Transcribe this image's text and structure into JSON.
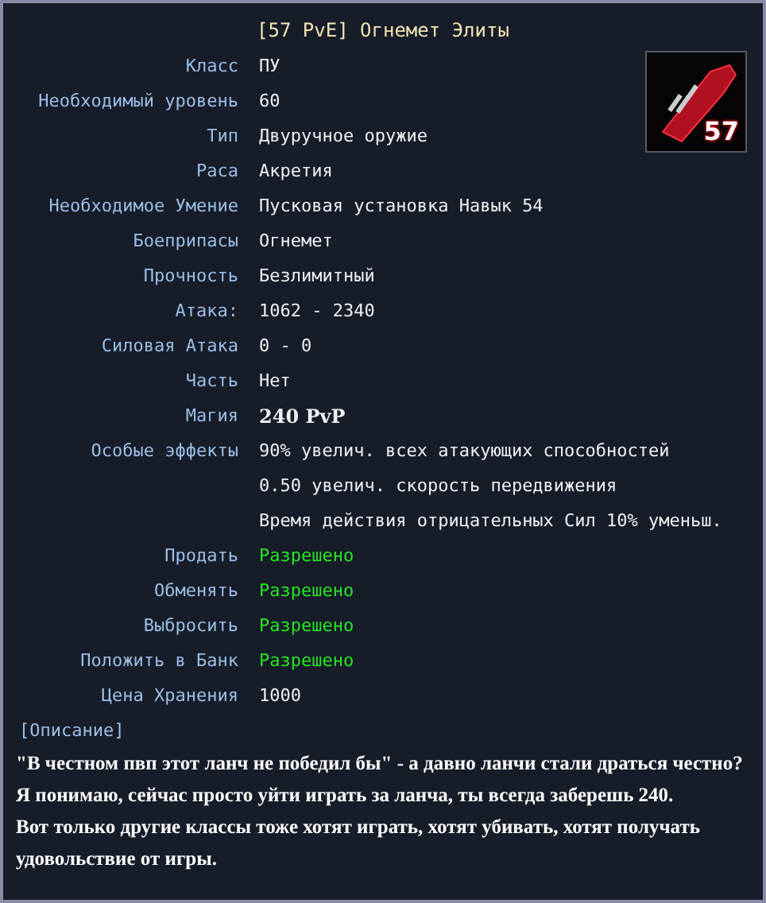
{
  "title": "[57 PvE] Огнемет Элиты",
  "icon_badge": "57",
  "rows": [
    {
      "label": "Класс",
      "value": "ПУ",
      "kind": "text"
    },
    {
      "label": "Необходимый уровень",
      "value": "60",
      "kind": "text"
    },
    {
      "label": "Тип",
      "value": "Двуручное оружие",
      "kind": "text"
    },
    {
      "label": "Раса",
      "value": "Акретия",
      "kind": "text"
    },
    {
      "label": "Необходимое Умение",
      "value": "Пусковая установка Навык 54",
      "kind": "text"
    },
    {
      "label": "Боеприпасы",
      "value": "Огнемет",
      "kind": "text"
    },
    {
      "label": "Прочность",
      "value": "Безлимитный",
      "kind": "text"
    },
    {
      "label": "Атака:",
      "value": "1062 - 2340",
      "kind": "text"
    },
    {
      "label": "Силовая Атака",
      "value": "0 - 0",
      "kind": "text"
    },
    {
      "label": "Часть",
      "value": "Нет",
      "kind": "text"
    },
    {
      "label": "Магия",
      "value": "240 PvP",
      "kind": "magic"
    },
    {
      "label": "Особые эффекты",
      "value": "90% увелич. всех атакующих способностей",
      "kind": "text"
    },
    {
      "value": "0.50 увелич. скорость передвижения",
      "kind": "text"
    },
    {
      "value": "Время действия отрицательных Сил 10% уменьш.",
      "kind": "text"
    },
    {
      "label": "Продать",
      "value": "Разрешено",
      "kind": "allowed"
    },
    {
      "label": "Обменять",
      "value": "Разрешено",
      "kind": "allowed"
    },
    {
      "label": "Выбросить",
      "value": "Разрешено",
      "kind": "allowed"
    },
    {
      "label": "Положить в Банк",
      "value": "Разрешено",
      "kind": "allowed"
    },
    {
      "label": "Цена Хранения",
      "value": "1000",
      "kind": "text"
    }
  ],
  "description_heading": "[Описание]",
  "description": [
    "\"В честном пвп этот ланч не победил бы\" - а давно ланчи стали драться честно?",
    "Я понимаю, сейчас просто уйти играть за ланча, ты всегда заберешь 240.",
    "Вот только другие классы тоже хотят играть, хотят убивать, хотят получать удовольствие от игры."
  ]
}
